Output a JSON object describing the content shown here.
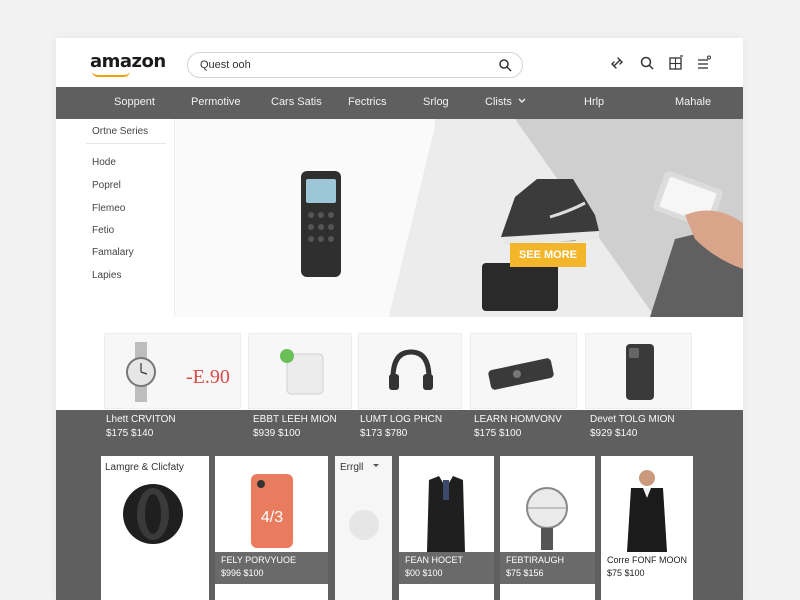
{
  "header": {
    "logo": "amazon",
    "search": {
      "value": "Quest ooh",
      "placeholder": ""
    },
    "icons": [
      "link-icon",
      "search-icon",
      "grid-icon",
      "list-icon"
    ]
  },
  "nav": {
    "items": [
      "Soppent",
      "Permotive",
      "Cars Satis",
      "Fectrics",
      "Srlog",
      "Clists",
      "Hrlp",
      "Mahale"
    ]
  },
  "sidebar": {
    "heading": "Ortne Series",
    "items": [
      "Hode",
      "Poprel",
      "Flemeo",
      "Fetio",
      "Famalary",
      "Lapies"
    ]
  },
  "hero": {
    "cta": "SEE MORE"
  },
  "row1": {
    "price_overlay": "-E.90",
    "products": [
      {
        "name": "Lhett CRVITON",
        "price": "$175 $140",
        "icon": "watch-icon"
      },
      {
        "name": "EBBT LEEH MION",
        "price": "$939 $100",
        "icon": "speaker-icon"
      },
      {
        "name": "LUMT LOG PHCN",
        "price": "$173 $780",
        "icon": "headphones-icon"
      },
      {
        "name": "LEARN HOMVONV",
        "price": "$175 $100",
        "icon": "camera-icon"
      },
      {
        "name": "Devet TOLG MION",
        "price": "$929 $140",
        "icon": "phone-case-icon"
      }
    ]
  },
  "cards": {
    "first_label": "Lamgre & Clicfaty",
    "dropdown_label": "Errgll",
    "items": [
      {
        "name": "FELY PORVYUOE",
        "price": "$996 $100",
        "icon": "phone-case-icon"
      },
      {
        "name": "FEAN HOCET",
        "price": "$00 $100",
        "icon": "vest-icon"
      },
      {
        "name": "FEBTIRAUGH",
        "price": "$75 $156",
        "icon": "watch-icon"
      },
      {
        "name": "Corre FONF MOON",
        "price": "$75 $100",
        "icon": "suit-icon"
      }
    ]
  },
  "colors": {
    "nav": "#5f5f5f",
    "accent": "#f3b52a",
    "price": "#d94a4a"
  }
}
